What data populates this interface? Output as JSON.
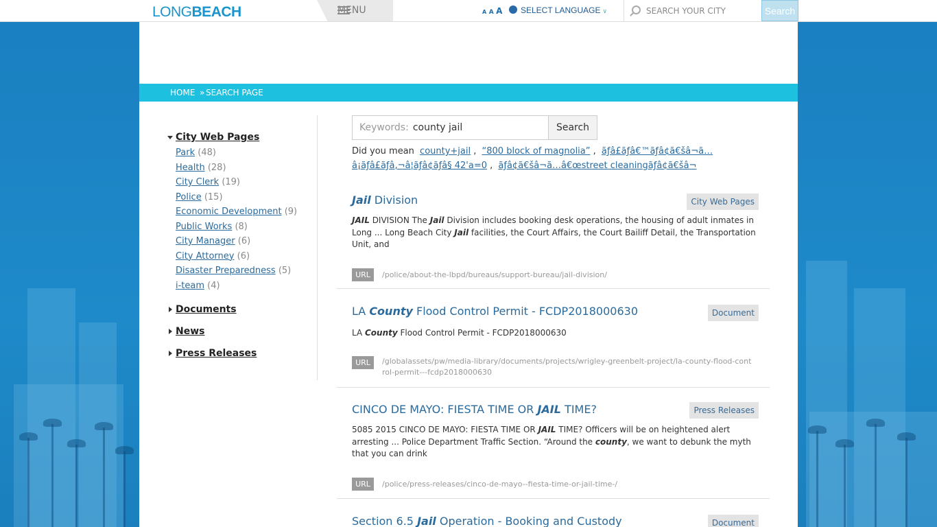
{
  "header": {
    "logo_left": "LONG",
    "logo_right": "BEACH",
    "menu_label": "MENU",
    "text_size_small": "A",
    "text_size_mid": "A",
    "text_size_large": "A",
    "language_label": "SELECT LANGUAGE",
    "search_placeholder": "SEARCH YOUR CITY",
    "search_button": "Search"
  },
  "breadcrumb": {
    "home": "HOME",
    "separator": "»",
    "current": "SEARCH PAGE"
  },
  "sidebar": {
    "facets": [
      {
        "label": "City Web Pages",
        "expanded": true,
        "items": [
          {
            "label": "Park",
            "count": "(48)"
          },
          {
            "label": "Health",
            "count": "(28)"
          },
          {
            "label": "City Clerk",
            "count": "(19)"
          },
          {
            "label": "Police",
            "count": "(15)"
          },
          {
            "label": "Economic Development",
            "count": "(9)"
          },
          {
            "label": "Public Works",
            "count": "(8)"
          },
          {
            "label": "City Manager",
            "count": "(6)"
          },
          {
            "label": "City Attorney",
            "count": "(6)"
          },
          {
            "label": "Disaster Preparedness",
            "count": "(5)"
          },
          {
            "label": "i-team",
            "count": "(4)"
          }
        ]
      },
      {
        "label": "Documents",
        "expanded": false
      },
      {
        "label": "News",
        "expanded": false
      },
      {
        "label": "Press Releases",
        "expanded": false
      }
    ]
  },
  "search": {
    "keywords_label": "Keywords:",
    "keywords_value": "county jail",
    "button": "Search",
    "did_you_mean_label": "Did you mean",
    "suggestions": [
      "county+jail",
      "“800 block of magnolia”",
      "ãƒâ£ãƒâ€™ãƒâ¢ã€šâ¬ã…",
      "â¡ãƒâ£ãƒâ‚¬â¦ãƒâ¢ãƒâ§ 42'a=0",
      "ãƒâ¢ã€šâ¬ã…â€œstreet cleaningãƒâ¢ã€šâ¬"
    ]
  },
  "results": [
    {
      "title_pre": "",
      "title_em": "Jail",
      "title_post": " Division",
      "tag": "City Web Pages",
      "desc": [
        {
          "t": "JAIL",
          "em": true
        },
        {
          "t": " DIVISION The ",
          "em": false
        },
        {
          "t": "Jail",
          "em": true
        },
        {
          "t": " Division includes booking desk operations, the housing of adult inmates in Long ... Long Beach City ",
          "em": false
        },
        {
          "t": "Jail",
          "em": true
        },
        {
          "t": " facilities, the Court Affairs, the Court Bailiff Detail, the Transportation Unit, and",
          "em": false
        }
      ],
      "url_label": "URL",
      "url": "/police/about-the-lbpd/bureaus/support-bureau/jail-division/"
    },
    {
      "title_pre": "LA ",
      "title_em": "County",
      "title_post": " Flood Control Permit - FCDP2018000630",
      "tag": "Document",
      "desc": [
        {
          "t": "LA ",
          "em": false
        },
        {
          "t": "County",
          "em": true
        },
        {
          "t": " Flood Control Permit - FCDP2018000630",
          "em": false
        }
      ],
      "url_label": "URL",
      "url": "/globalassets/pw/media-library/documents/projects/wrigley-greenbelt-project/la-county-flood-control-permit---fcdp2018000630"
    },
    {
      "title_pre": "CINCO DE MAYO: FIESTA TIME OR ",
      "title_em": "JAIL",
      "title_post": " TIME?",
      "tag": "Press Releases",
      "desc": [
        {
          "t": "5085 2015 CINCO DE MAYO: FIESTA TIME OR ",
          "em": false
        },
        {
          "t": "JAIL",
          "em": true
        },
        {
          "t": " TIME? Officers will be on heightened alert arresting ... Police Department Traffic Section. “Around the ",
          "em": false
        },
        {
          "t": "county",
          "em": true
        },
        {
          "t": ", we want to debunk the myth that you can drink",
          "em": false
        }
      ],
      "url_label": "URL",
      "url": "/police/press-releases/cinco-de-mayo--fiesta-time-or-jail-time-/"
    },
    {
      "title_pre": "Section 6.5 ",
      "title_em": "Jail",
      "title_post": " Operation - Booking and Custody",
      "tag": "Document",
      "desc": [],
      "url_label": "",
      "url": ""
    }
  ]
}
